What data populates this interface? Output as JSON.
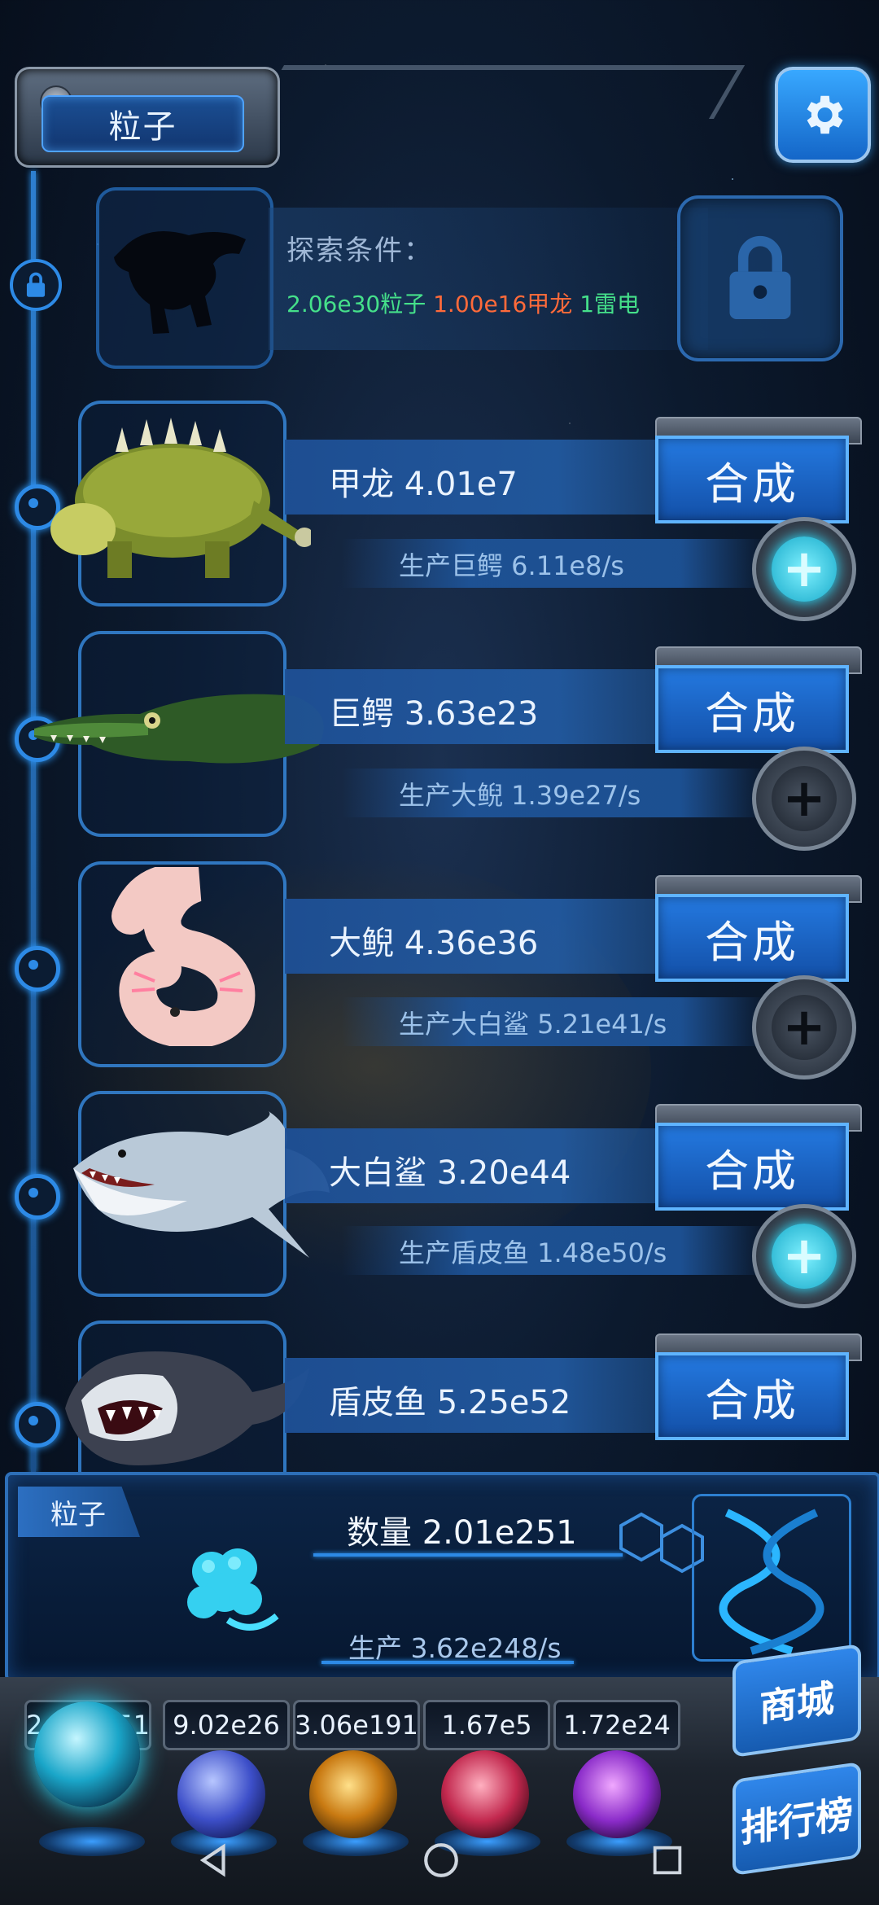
{
  "header": {
    "title": "粒子"
  },
  "explore": {
    "label": "探索条件：",
    "conditions": [
      {
        "text": "2.06e30粒子",
        "color": "#45e08a"
      },
      {
        "text": "1.00e16甲龙",
        "color": "#ff6a3a"
      },
      {
        "text": "1雷电",
        "color": "#45e08a"
      }
    ]
  },
  "creatures": [
    {
      "name": "甲龙 4.01e7",
      "produce": "生产巨鳄 6.11e8/s",
      "synth": "合成",
      "plus_active": true,
      "icon": "ankylosaurus-icon"
    },
    {
      "name": "巨鳄 3.63e23",
      "produce": "生产大鲵 1.39e27/s",
      "synth": "合成",
      "plus_active": false,
      "icon": "crocodile-icon"
    },
    {
      "name": "大鲵 4.36e36",
      "produce": "生产大白鲨 5.21e41/s",
      "synth": "合成",
      "plus_active": false,
      "icon": "axolotl-icon"
    },
    {
      "name": "大白鲨 3.20e44",
      "produce": "生产盾皮鱼 1.48e50/s",
      "synth": "合成",
      "plus_active": true,
      "icon": "shark-icon"
    },
    {
      "name": "盾皮鱼 5.25e52",
      "produce": "",
      "synth": "合成",
      "plus_active": false,
      "icon": "placoderm-icon"
    }
  ],
  "particle_panel": {
    "tab": "粒子",
    "quantity": "数量 2.01e251",
    "production": "生产 3.62e248/s"
  },
  "resources": [
    {
      "value": "2.01e251",
      "icon": "particle-orb-icon"
    },
    {
      "value": "9.02e26",
      "icon": "lightning-orb-icon"
    },
    {
      "value": "3.06e191",
      "icon": "fire-orb-icon"
    },
    {
      "value": "1.67e5",
      "icon": "brain-orb-icon"
    },
    {
      "value": "1.72e24",
      "icon": "vortex-orb-icon"
    }
  ],
  "side_buttons": {
    "shop": "商城",
    "rank": "排行榜"
  },
  "colors": {
    "accent": "#2d8ae6",
    "synth": "#1f6fd6",
    "plus_on": "#22e0ff"
  }
}
